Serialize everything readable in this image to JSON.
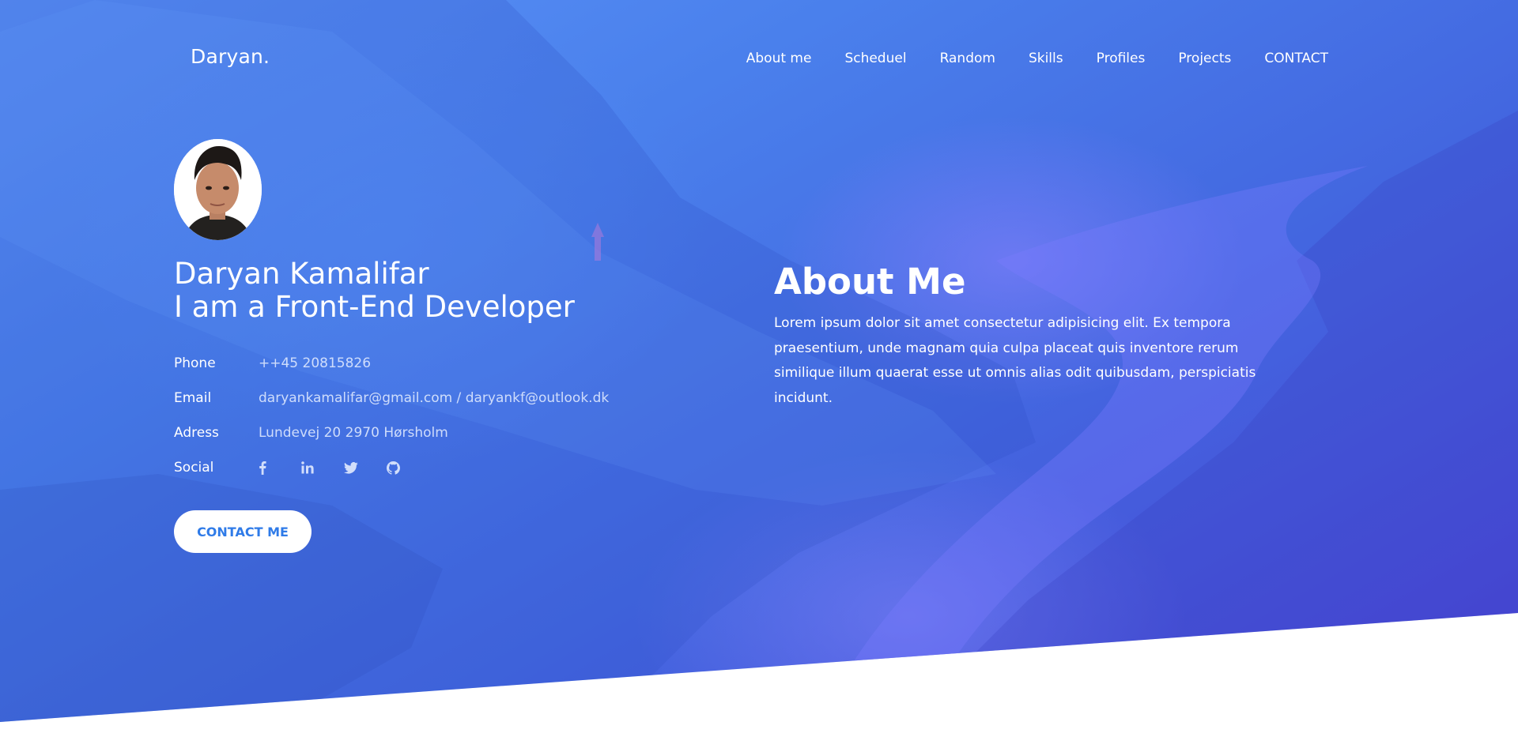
{
  "brand": "Daryan.",
  "nav": [
    {
      "label": "About me"
    },
    {
      "label": "Scheduel"
    },
    {
      "label": "Random"
    },
    {
      "label": "Skills"
    },
    {
      "label": "Profiles"
    },
    {
      "label": "Projects"
    },
    {
      "label": "CONTACT"
    }
  ],
  "profile": {
    "name": "Daryan Kamalifar",
    "role": "I am a Front-End Developer",
    "phone_label": "Phone",
    "phone": "++45 20815826",
    "email_label": "Email",
    "email": "daryankamalifar@gmail.com / daryankf@outlook.dk",
    "address_label": "Adress",
    "address": "Lundevej 20 2970 Hørsholm",
    "social_label": "Social",
    "social_icons": [
      "facebook-icon",
      "linkedin-icon",
      "twitter-icon",
      "github-icon"
    ],
    "cta": "CONTACT ME"
  },
  "about": {
    "title": "About Me",
    "text": "Lorem ipsum dolor sit amet consectetur adipisicing elit. Ex tempora praesentium, unde magnam quia culpa placeat quis inventore rerum similique illum quaerat esse ut omnis alias odit quibusdam, perspiciatis incidunt."
  },
  "colors": {
    "gradient_start": "#5b93f7",
    "gradient_end": "#4a3fd3",
    "button_text": "#2f7be8",
    "text": "#ffffff"
  }
}
